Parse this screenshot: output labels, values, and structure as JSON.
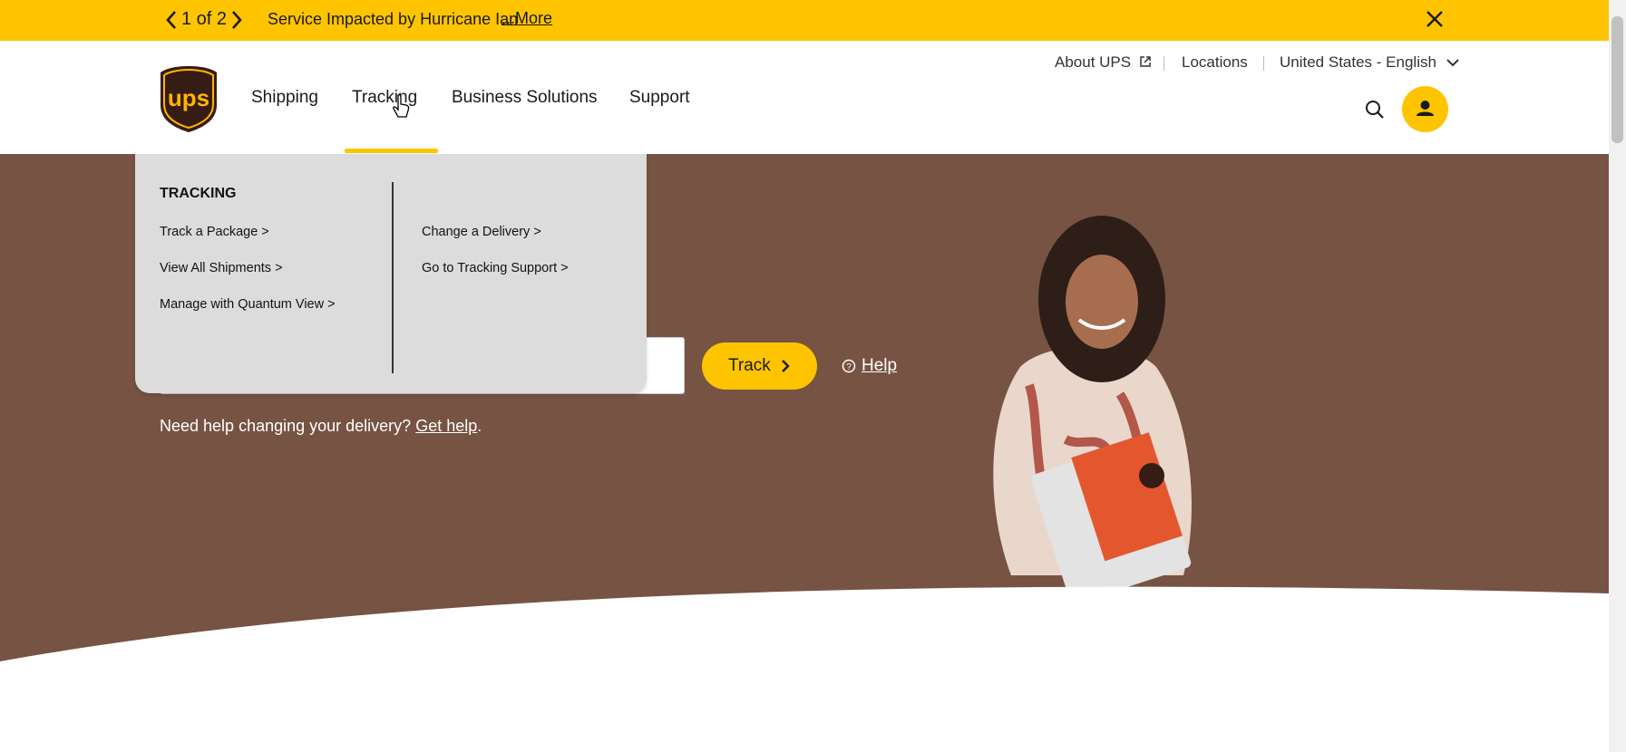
{
  "alert": {
    "counter": "1 of 2",
    "message": "Service Impacted by Hurricane Ian",
    "more_label": "...More",
    "prev_icon": "chevron-left-icon",
    "next_icon": "chevron-right-icon",
    "close_icon": "close-icon"
  },
  "header": {
    "logo": "ups",
    "nav": [
      {
        "label": "Shipping"
      },
      {
        "label": "Tracking",
        "active": true
      },
      {
        "label": "Business Solutions"
      },
      {
        "label": "Support"
      }
    ],
    "utility": {
      "about": "About UPS",
      "locations": "Locations",
      "language": "United States - English"
    },
    "search_icon": "search-icon",
    "account_icon": "user-icon"
  },
  "dropdown": {
    "heading": "TRACKING",
    "left_links": [
      {
        "label": "Track a Package  >"
      },
      {
        "label": "View All Shipments  >"
      },
      {
        "label": "Manage with Quantum View  >"
      }
    ],
    "right_links": [
      {
        "label": "Change a Delivery  >"
      },
      {
        "label": "Go to Tracking Support  >"
      }
    ]
  },
  "hero": {
    "track_button": "Track",
    "help_link": "Help",
    "need_help_text": "Need help changing your delivery?",
    "get_help_link": "Get help",
    "get_help_suffix": "."
  },
  "colors": {
    "brand_yellow": "#ffc400",
    "hero_brown": "#775343",
    "dropdown_bg": "#dcdcdc"
  }
}
